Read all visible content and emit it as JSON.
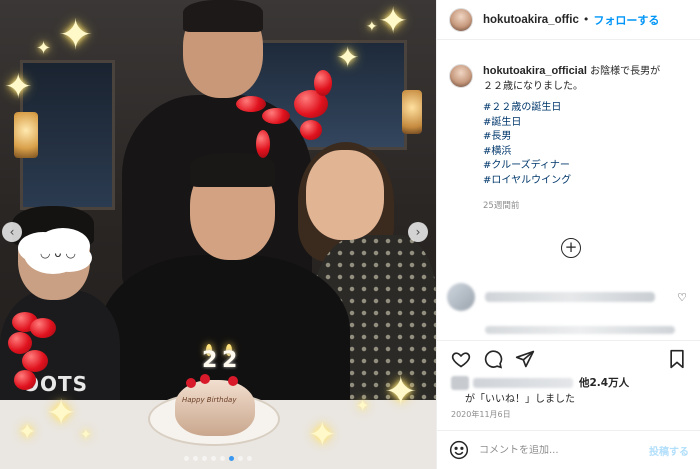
{
  "photo": {
    "shirt_text": "OOTS",
    "cake_text": "Happy Birthday",
    "candle_left": "2",
    "candle_right": "2",
    "cloud_face": "◡ ᴗ ◡"
  },
  "header": {
    "username": "hokutoakira_offic",
    "separator": "•",
    "follow_label": "フォローする"
  },
  "caption": {
    "username": "hokutoakira_official",
    "text": " お陰様で長男が\n２２歳になりました。",
    "hashtags": [
      "#２２歳の誕生日",
      "#誕生日",
      "#長男",
      "#横浜",
      "#クルーズディナー",
      "#ロイヤルウイング"
    ],
    "time_ago": "25週間前"
  },
  "likes": {
    "count": "他2.4万人",
    "suffix": "が「いいね！」しました"
  },
  "date": "2020年11月6日",
  "comment": {
    "placeholder": "コメントを追加...",
    "post_label": "投稿する"
  },
  "colors": {
    "accent": "#0095f6",
    "hashtag": "#00376b",
    "muted": "#8e8e8e",
    "post_disabled": "#b2dffc"
  },
  "icons": [
    "heart-icon",
    "comment-icon",
    "share-icon",
    "bookmark-icon",
    "smile-icon",
    "plus-circle-icon",
    "chevron-left-icon",
    "chevron-right-icon"
  ]
}
